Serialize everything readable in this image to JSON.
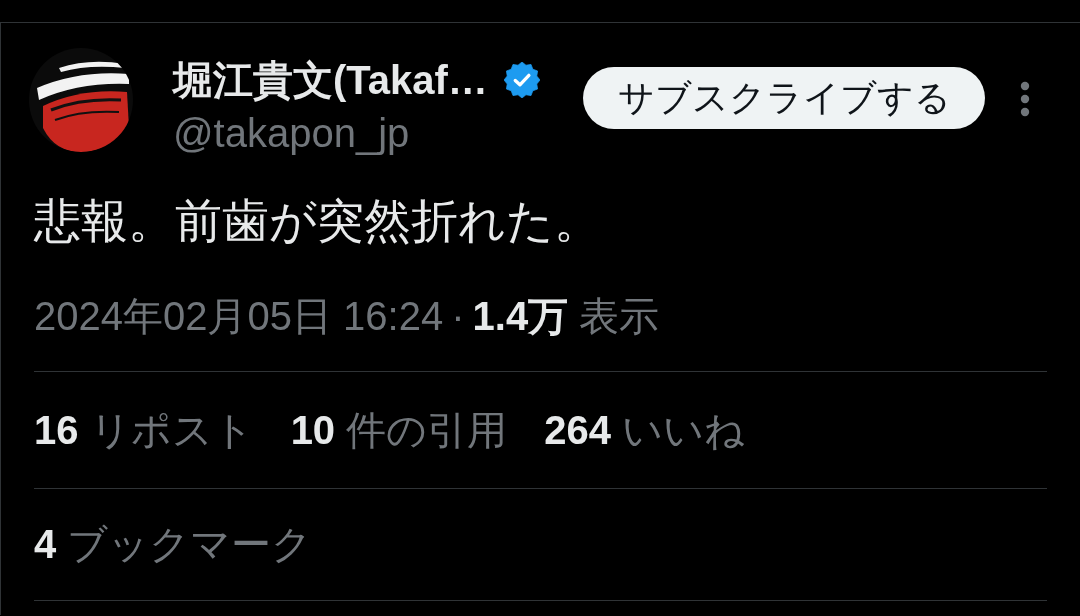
{
  "tweet": {
    "author": {
      "name": "堀江貴文(Takaf…",
      "verified": true,
      "handle": "@takapon_jp"
    },
    "subscribe_button": "サブスクライブする",
    "text": "悲報。前歯が突然折れた。",
    "meta": {
      "timestamp": "2024年02月05日 16:24",
      "separator": "·",
      "views_count": "1.4万",
      "views_label": "表示"
    },
    "stat_rows": [
      {
        "items": [
          {
            "count": "16",
            "label": "リポスト"
          },
          {
            "count": "10",
            "label": "件の引用"
          },
          {
            "count": "264",
            "label": "いいね"
          }
        ]
      },
      {
        "items": [
          {
            "count": "4",
            "label": "ブックマーク"
          }
        ]
      }
    ]
  }
}
